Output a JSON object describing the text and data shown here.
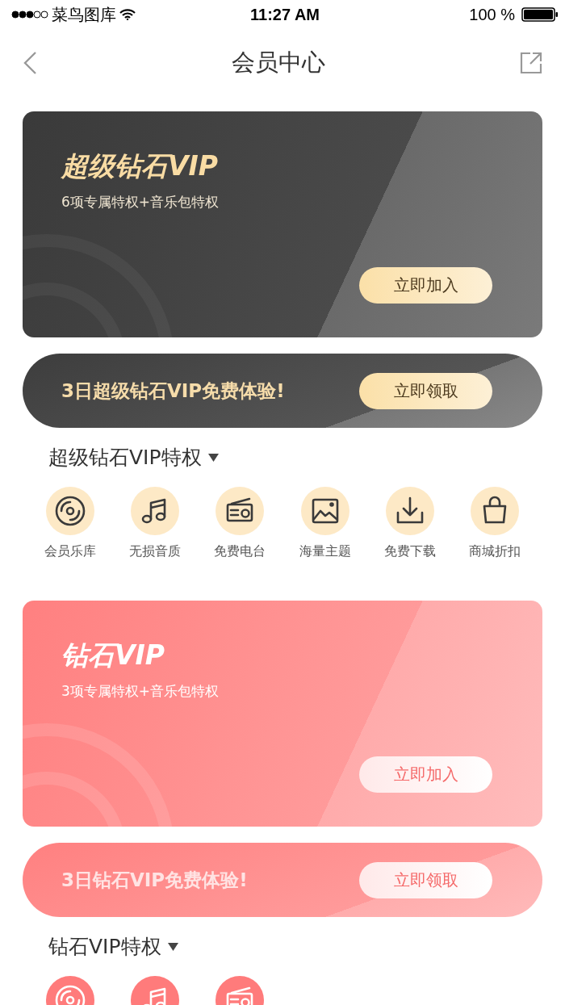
{
  "status_bar": {
    "carrier": "菜鸟图库",
    "time": "11:27 AM",
    "battery": "100 %"
  },
  "nav": {
    "title": "会员中心"
  },
  "tiers": [
    {
      "kind": "gold",
      "card": {
        "title": "超级钻石VIP",
        "subtitle": "6项专属特权+音乐包特权",
        "button": "立即加入"
      },
      "trial": {
        "text": "3日超级钻石VIP免费体验!",
        "button": "立即领取"
      },
      "perks_title": "超级钻石VIP特权",
      "perks": [
        {
          "kind": "disc",
          "label": "会员乐库"
        },
        {
          "kind": "music",
          "label": "无损音质"
        },
        {
          "kind": "radio",
          "label": "免费电台"
        },
        {
          "kind": "image",
          "label": "海量主题"
        },
        {
          "kind": "download",
          "label": "免费下载"
        },
        {
          "kind": "bag",
          "label": "商城折扣"
        }
      ]
    },
    {
      "kind": "pink",
      "card": {
        "title": "钻石VIP",
        "subtitle": "3项专属特权+音乐包特权",
        "button": "立即加入"
      },
      "trial": {
        "text": "3日钻石VIP免费体验!",
        "button": "立即领取"
      },
      "perks_title": "钻石VIP特权",
      "perks": [
        {
          "kind": "disc"
        },
        {
          "kind": "music"
        },
        {
          "kind": "radio"
        }
      ]
    }
  ]
}
